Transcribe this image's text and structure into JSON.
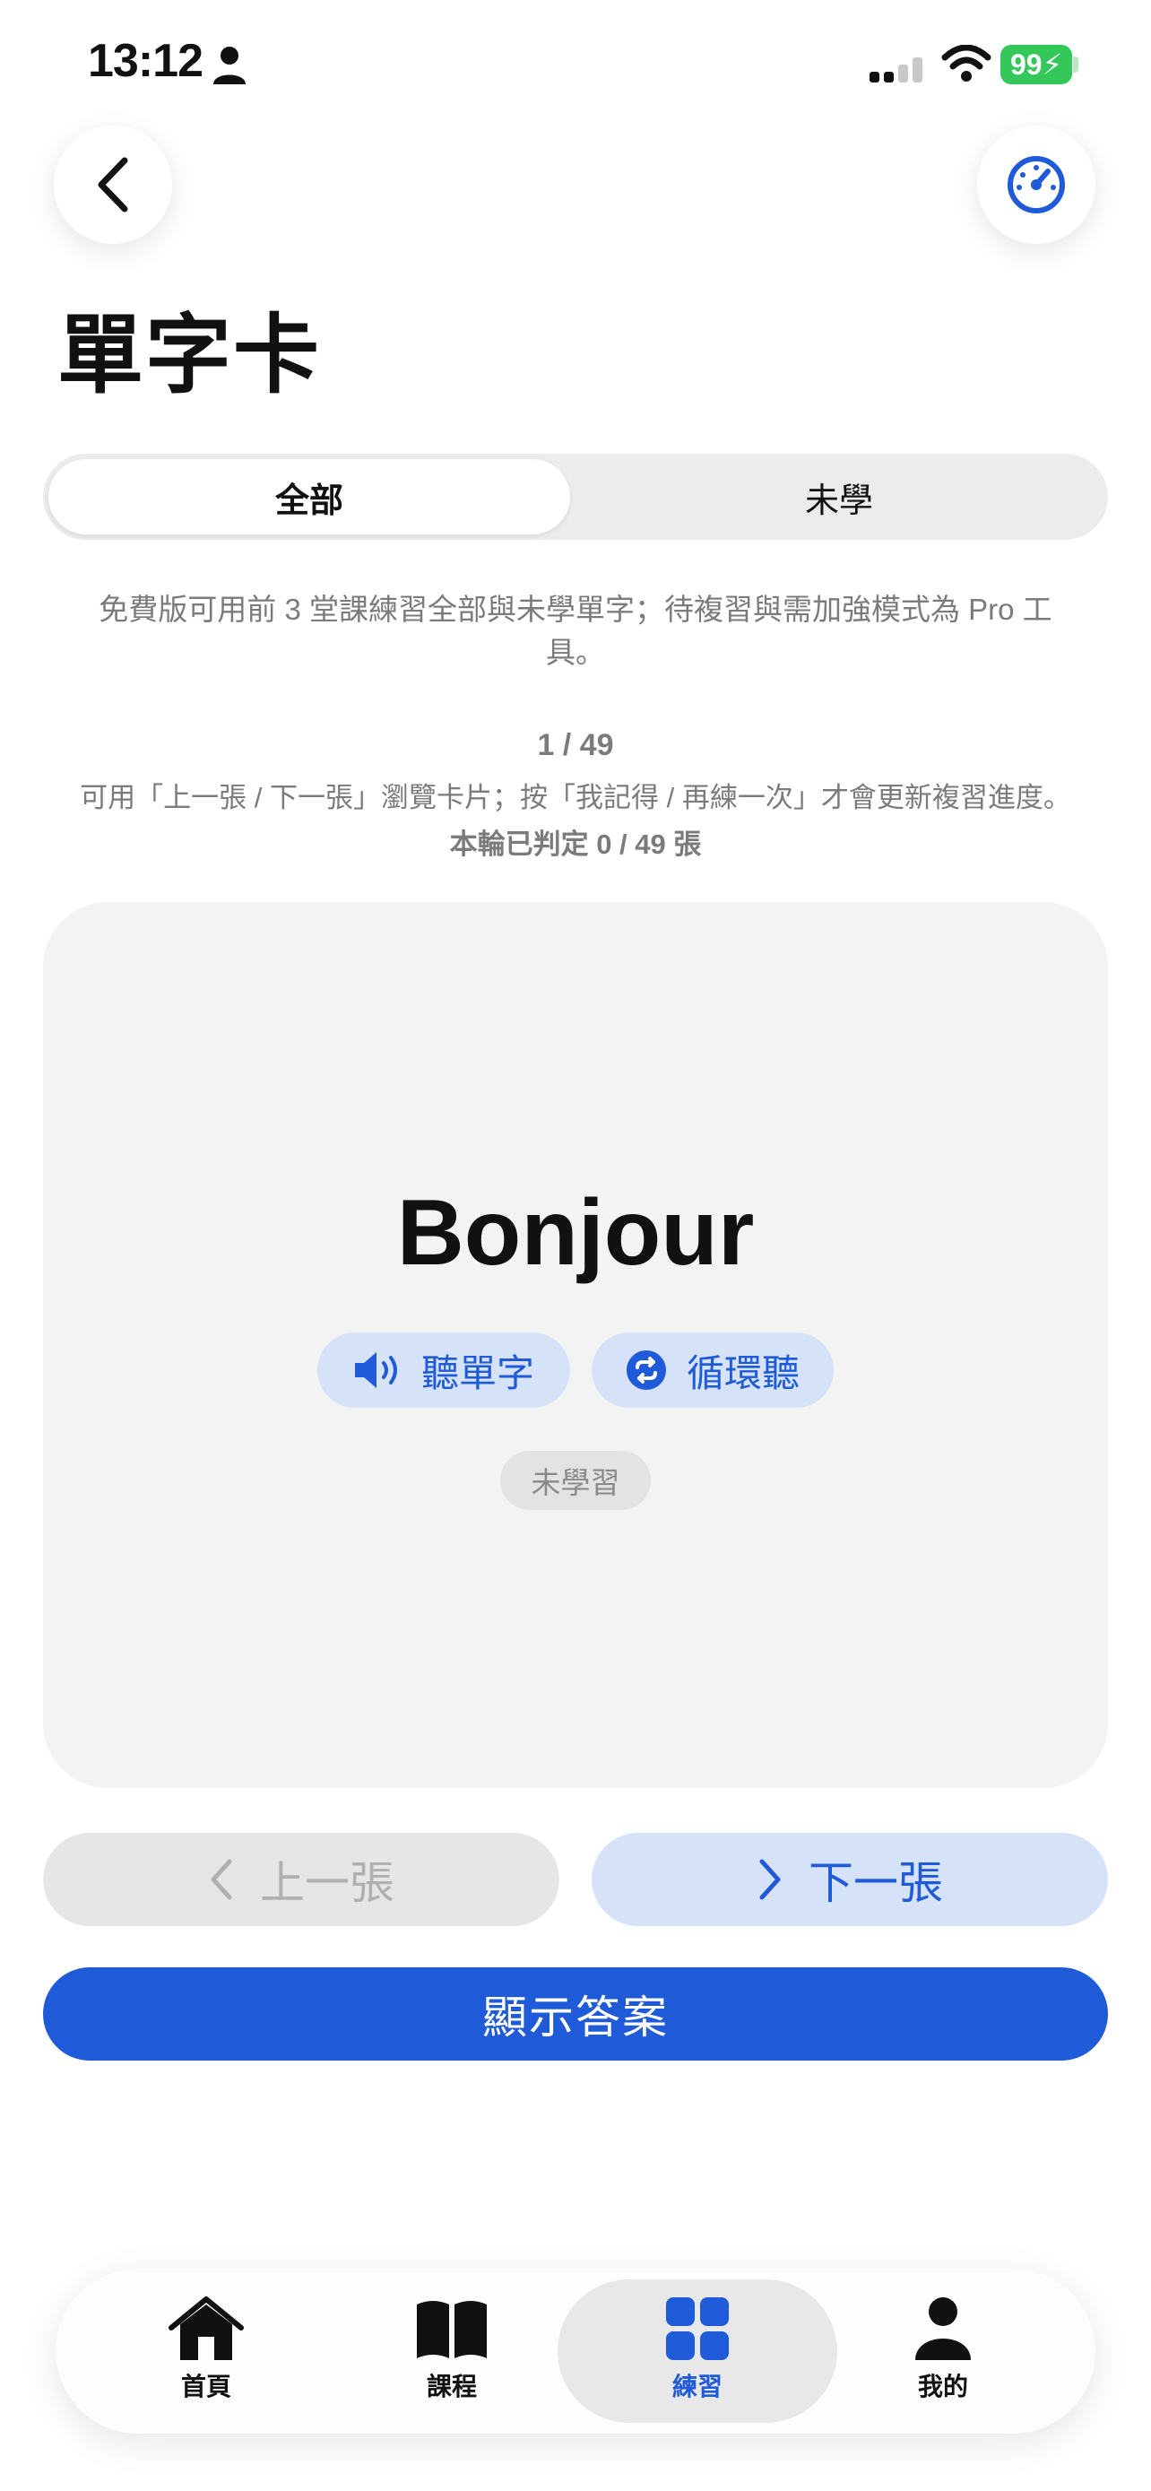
{
  "status_bar": {
    "time": "13:12",
    "battery": "99"
  },
  "header": {
    "title": "單字卡"
  },
  "segmented": {
    "all_label": "全部",
    "unlearned_label": "未學",
    "selected": "全部"
  },
  "notice": "免費版可用前 3 堂課練習全部與未學單字；待複習與需加強模式為 Pro 工具。",
  "progress": {
    "counter": "1 / 49",
    "hint": "可用「上一張 / 下一張」瀏覽卡片；按「我記得 / 再練一次」才會更新複習進度。",
    "judged": "本輪已判定 0 / 49 張"
  },
  "card": {
    "word": "Bonjour",
    "listen_label": "聽單字",
    "loop_label": "循環聽",
    "status_badge": "未學習"
  },
  "navigation": {
    "prev_label": "上一張",
    "next_label": "下一張"
  },
  "show_answer_label": "顯示答案",
  "tabbar": {
    "items": [
      {
        "label": "首頁",
        "icon": "house-icon"
      },
      {
        "label": "課程",
        "icon": "book-icon"
      },
      {
        "label": "練習",
        "icon": "grid-icon",
        "active": true
      },
      {
        "label": "我的",
        "icon": "person-icon"
      }
    ]
  },
  "colors": {
    "accent": "#1f5ad8",
    "accent_light": "#d6e2f7",
    "card_bg": "#f3f3f3",
    "battery": "#34c759"
  }
}
